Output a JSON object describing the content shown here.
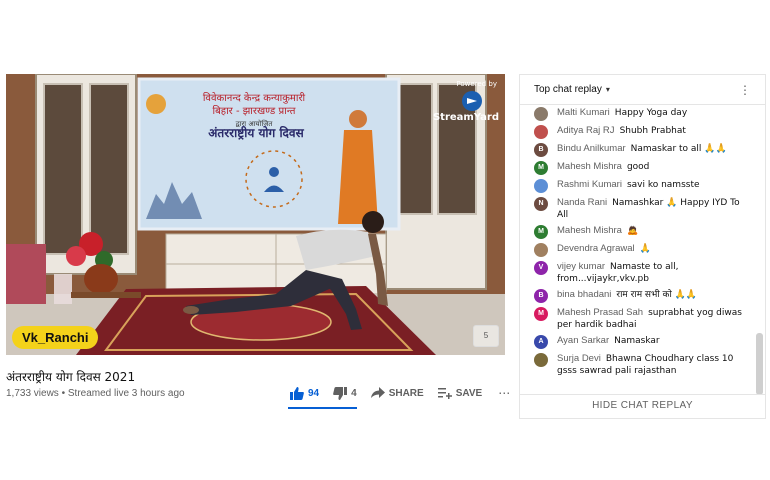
{
  "video": {
    "banner_line1": "विवेकानन्द केन्द्र कन्याकुमारी",
    "banner_line2": "बिहार - झारखण्ड प्रान्त",
    "banner_line3": "द्वारा आयोजित",
    "banner_title": "अंतरराष्ट्रीय योग दिवस",
    "powered_by": "Powered by",
    "streamyard": "StreamYard",
    "name_tag": "Vk_Ranchi",
    "corner_badge": "5",
    "title": "अंतरराष्ट्रीय योग दिवस 2021",
    "meta": "1,733 views • Streamed live 3 hours ago"
  },
  "actions": {
    "likes": "94",
    "dislikes": "4",
    "share": "SHARE",
    "save": "SAVE",
    "more": "⋯"
  },
  "chat": {
    "header": "Top chat replay",
    "caret": "▾",
    "kebab": "⋮",
    "hide_label": "HIDE CHAT REPLAY",
    "messages": [
      {
        "author": "Malti Kumari",
        "text": "Happy Yoga day",
        "avatar_letter": "",
        "avatar_color": "#8a7a6a"
      },
      {
        "author": "Aditya Raj RJ",
        "text": "Shubh Prabhat",
        "avatar_letter": "",
        "avatar_color": "#c0504d"
      },
      {
        "author": "Bindu Anilkumar",
        "text": "Namaskar to all 🙏🙏",
        "avatar_letter": "B",
        "avatar_color": "#6d4c41"
      },
      {
        "author": "Mahesh Mishra",
        "text": "good",
        "avatar_letter": "M",
        "avatar_color": "#2e7d32"
      },
      {
        "author": "Rashmi Kumari",
        "text": "savi ko namsste",
        "avatar_letter": "",
        "avatar_color": "#5c8fd6"
      },
      {
        "author": "Nanda Rani",
        "text": "Namashkar 🙏 Happy IYD To All",
        "avatar_letter": "N",
        "avatar_color": "#6d4c41"
      },
      {
        "author": "Mahesh Mishra",
        "text": "🙇",
        "avatar_letter": "M",
        "avatar_color": "#2e7d32"
      },
      {
        "author": "Devendra Agrawal",
        "text": "🙏",
        "avatar_letter": "",
        "avatar_color": "#a08060"
      },
      {
        "author": "vijey kumar",
        "text": "Namaste to all, from...vijaykr,vkv.pb",
        "avatar_letter": "V",
        "avatar_color": "#8e24aa"
      },
      {
        "author": "bina bhadani",
        "text": "राम राम सभी को 🙏🙏",
        "avatar_letter": "B",
        "avatar_color": "#8e24aa"
      },
      {
        "author": "Mahesh Prasad Sah",
        "text": "suprabhat yog diwas per hardik badhai",
        "avatar_letter": "M",
        "avatar_color": "#d81b60"
      },
      {
        "author": "Ayan Sarkar",
        "text": "Namaskar",
        "avatar_letter": "A",
        "avatar_color": "#3949ab"
      },
      {
        "author": "Surja Devi",
        "text": "Bhawna Choudhary class 10 gsss sawrad pali rajasthan",
        "avatar_letter": "",
        "avatar_color": "#7a6a3a"
      }
    ]
  }
}
